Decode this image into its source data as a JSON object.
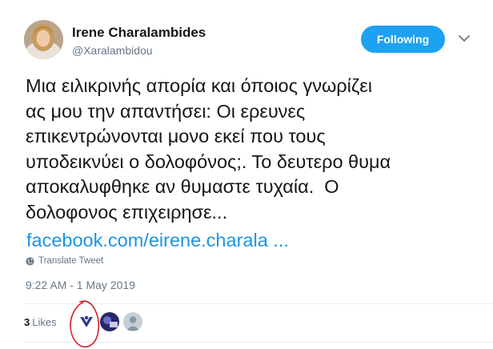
{
  "author": {
    "name": "Irene Charalambides",
    "handle": "@Xaralambidou"
  },
  "follow_button": {
    "label": "Following",
    "color": "#1da1f2"
  },
  "tweet": {
    "text": "Μια ειλικρινής απορία και όποιος γνωρίζει\nας μου την απαντήσει: Οι ερευνες\nεπικεντρώνονται μονο εκεί που τους\nυποδεικνύει ο δολοφόνος;. Το δευτερο θυμα\nαποκαλυφθηκε αν θυμαστε τυχαία.  Ο\nδολοφονος επιχειρησε...",
    "link": "facebook.com/eirene.charala ...",
    "link_color": "#1b95e0",
    "translate_label": "Translate Tweet",
    "timestamp": "9:22 AM - 1 May 2019"
  },
  "engagement": {
    "likes_count": "3",
    "likes_label": "Likes"
  },
  "icons": {
    "caret": "chevron-down-icon",
    "translate": "globe-icon"
  },
  "annotation_color": "#d0202a"
}
